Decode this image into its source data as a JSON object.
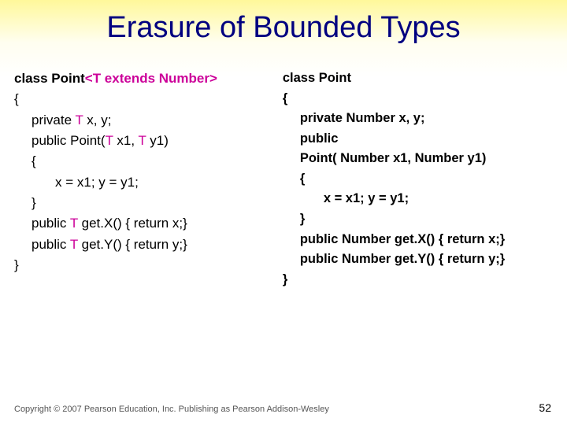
{
  "title": "Erasure of Bounded Types",
  "left": {
    "l1a": "class Point",
    "l1b": "<T extends Number>",
    "l2": " {",
    "l3a": "private ",
    "l3b": "T",
    "l3c": " x, y;",
    "l4a": "public Point(",
    "l4b": "T",
    "l4c": " x1, ",
    "l4d": "T",
    "l4e": " y1)",
    "l5": "{",
    "l6": "x = x1; y = y1;",
    "l7": "}",
    "l8a": "public ",
    "l8b": "T",
    "l8c": " get.X() { return x;}",
    "l9a": "public ",
    "l9b": "T",
    "l9c": " get.Y() { return y;}",
    "l10": " }"
  },
  "right": {
    "l1": "class Point",
    "l2": " {",
    "l3": "private Number x, y;",
    "l4": "public",
    "l5": "Point( Number x1,  Number y1)",
    "l6": "{",
    "l7": "x = x1; y = y1;",
    "l8": "}",
    "l9": "public Number get.X() { return x;}",
    "l10": "public Number get.Y() { return y;}",
    "l11": " }"
  },
  "footer": "Copyright © 2007 Pearson Education, Inc. Publishing as Pearson Addison-Wesley",
  "pagenum": "52"
}
